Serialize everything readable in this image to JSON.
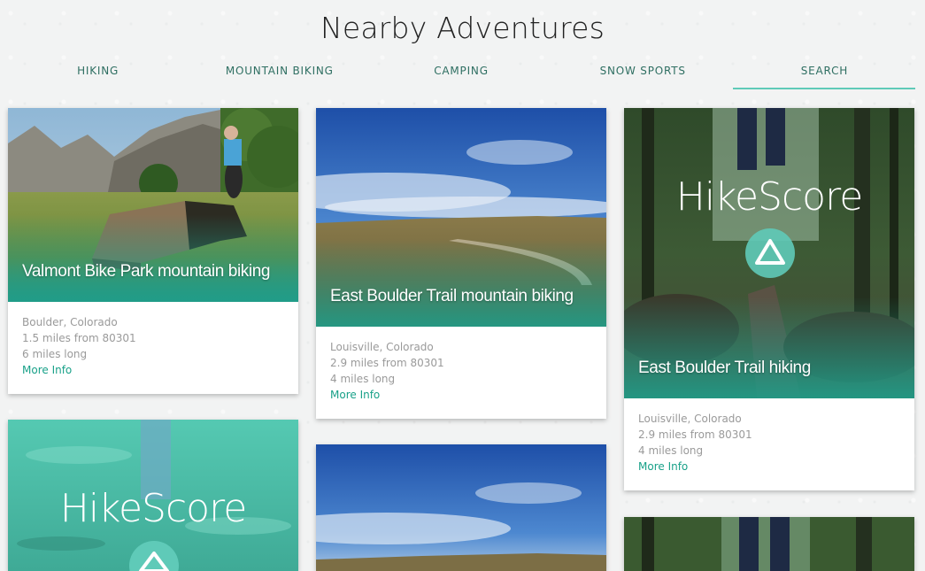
{
  "header": {
    "title": "Nearby Adventures"
  },
  "tabs": [
    {
      "label": "HIKING"
    },
    {
      "label": "MOUNTAIN BIKING"
    },
    {
      "label": "CAMPING"
    },
    {
      "label": "SNOW SPORTS"
    },
    {
      "label": "SEARCH"
    }
  ],
  "active_tab": "SEARCH",
  "colors": {
    "accent": "#5fcab8",
    "link": "#19a189",
    "tab_text": "#2f6f62"
  },
  "cards": [
    {
      "title": "Valmont Bike Park mountain biking",
      "location": "Boulder, Colorado",
      "distance": "1.5 miles from 80301",
      "length": "6 miles long",
      "link": "More Info",
      "image": "bike-park-photo"
    },
    {
      "title": "East Boulder Trail mountain biking",
      "location": "Louisville, Colorado",
      "distance": "2.9 miles from 80301",
      "length": "4 miles long",
      "link": "More Info",
      "image": "prairie-trail-photo"
    },
    {
      "title": "East Boulder Trail hiking",
      "location": "Louisville, Colorado",
      "distance": "2.9 miles from 80301",
      "length": "4 miles long",
      "link": "More Info",
      "image": "hikescore-logo-forest",
      "logo": "HikeScore"
    },
    {
      "title": "",
      "image": "hikescore-logo-water",
      "logo": "HikeScore"
    },
    {
      "title": "",
      "image": "prairie-trail-photo"
    },
    {
      "title": "",
      "image": "forest-photo"
    }
  ]
}
